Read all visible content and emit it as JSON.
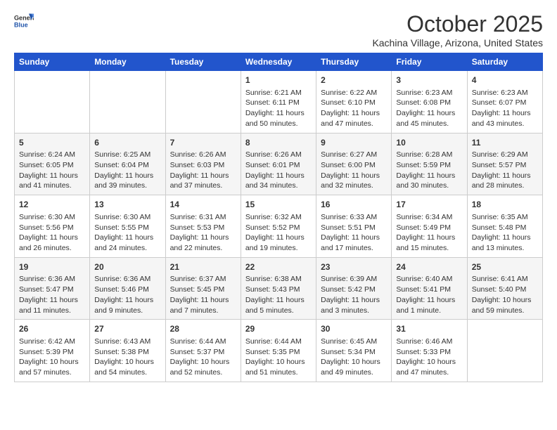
{
  "header": {
    "logo_general": "General",
    "logo_blue": "Blue",
    "month_title": "October 2025",
    "location": "Kachina Village, Arizona, United States"
  },
  "weekdays": [
    "Sunday",
    "Monday",
    "Tuesday",
    "Wednesday",
    "Thursday",
    "Friday",
    "Saturday"
  ],
  "weeks": [
    [
      {
        "date": "",
        "info": ""
      },
      {
        "date": "",
        "info": ""
      },
      {
        "date": "",
        "info": ""
      },
      {
        "date": "1",
        "info": "Sunrise: 6:21 AM\nSunset: 6:11 PM\nDaylight: 11 hours\nand 50 minutes."
      },
      {
        "date": "2",
        "info": "Sunrise: 6:22 AM\nSunset: 6:10 PM\nDaylight: 11 hours\nand 47 minutes."
      },
      {
        "date": "3",
        "info": "Sunrise: 6:23 AM\nSunset: 6:08 PM\nDaylight: 11 hours\nand 45 minutes."
      },
      {
        "date": "4",
        "info": "Sunrise: 6:23 AM\nSunset: 6:07 PM\nDaylight: 11 hours\nand 43 minutes."
      }
    ],
    [
      {
        "date": "5",
        "info": "Sunrise: 6:24 AM\nSunset: 6:05 PM\nDaylight: 11 hours\nand 41 minutes."
      },
      {
        "date": "6",
        "info": "Sunrise: 6:25 AM\nSunset: 6:04 PM\nDaylight: 11 hours\nand 39 minutes."
      },
      {
        "date": "7",
        "info": "Sunrise: 6:26 AM\nSunset: 6:03 PM\nDaylight: 11 hours\nand 37 minutes."
      },
      {
        "date": "8",
        "info": "Sunrise: 6:26 AM\nSunset: 6:01 PM\nDaylight: 11 hours\nand 34 minutes."
      },
      {
        "date": "9",
        "info": "Sunrise: 6:27 AM\nSunset: 6:00 PM\nDaylight: 11 hours\nand 32 minutes."
      },
      {
        "date": "10",
        "info": "Sunrise: 6:28 AM\nSunset: 5:59 PM\nDaylight: 11 hours\nand 30 minutes."
      },
      {
        "date": "11",
        "info": "Sunrise: 6:29 AM\nSunset: 5:57 PM\nDaylight: 11 hours\nand 28 minutes."
      }
    ],
    [
      {
        "date": "12",
        "info": "Sunrise: 6:30 AM\nSunset: 5:56 PM\nDaylight: 11 hours\nand 26 minutes."
      },
      {
        "date": "13",
        "info": "Sunrise: 6:30 AM\nSunset: 5:55 PM\nDaylight: 11 hours\nand 24 minutes."
      },
      {
        "date": "14",
        "info": "Sunrise: 6:31 AM\nSunset: 5:53 PM\nDaylight: 11 hours\nand 22 minutes."
      },
      {
        "date": "15",
        "info": "Sunrise: 6:32 AM\nSunset: 5:52 PM\nDaylight: 11 hours\nand 19 minutes."
      },
      {
        "date": "16",
        "info": "Sunrise: 6:33 AM\nSunset: 5:51 PM\nDaylight: 11 hours\nand 17 minutes."
      },
      {
        "date": "17",
        "info": "Sunrise: 6:34 AM\nSunset: 5:49 PM\nDaylight: 11 hours\nand 15 minutes."
      },
      {
        "date": "18",
        "info": "Sunrise: 6:35 AM\nSunset: 5:48 PM\nDaylight: 11 hours\nand 13 minutes."
      }
    ],
    [
      {
        "date": "19",
        "info": "Sunrise: 6:36 AM\nSunset: 5:47 PM\nDaylight: 11 hours\nand 11 minutes."
      },
      {
        "date": "20",
        "info": "Sunrise: 6:36 AM\nSunset: 5:46 PM\nDaylight: 11 hours\nand 9 minutes."
      },
      {
        "date": "21",
        "info": "Sunrise: 6:37 AM\nSunset: 5:45 PM\nDaylight: 11 hours\nand 7 minutes."
      },
      {
        "date": "22",
        "info": "Sunrise: 6:38 AM\nSunset: 5:43 PM\nDaylight: 11 hours\nand 5 minutes."
      },
      {
        "date": "23",
        "info": "Sunrise: 6:39 AM\nSunset: 5:42 PM\nDaylight: 11 hours\nand 3 minutes."
      },
      {
        "date": "24",
        "info": "Sunrise: 6:40 AM\nSunset: 5:41 PM\nDaylight: 11 hours\nand 1 minute."
      },
      {
        "date": "25",
        "info": "Sunrise: 6:41 AM\nSunset: 5:40 PM\nDaylight: 10 hours\nand 59 minutes."
      }
    ],
    [
      {
        "date": "26",
        "info": "Sunrise: 6:42 AM\nSunset: 5:39 PM\nDaylight: 10 hours\nand 57 minutes."
      },
      {
        "date": "27",
        "info": "Sunrise: 6:43 AM\nSunset: 5:38 PM\nDaylight: 10 hours\nand 54 minutes."
      },
      {
        "date": "28",
        "info": "Sunrise: 6:44 AM\nSunset: 5:37 PM\nDaylight: 10 hours\nand 52 minutes."
      },
      {
        "date": "29",
        "info": "Sunrise: 6:44 AM\nSunset: 5:35 PM\nDaylight: 10 hours\nand 51 minutes."
      },
      {
        "date": "30",
        "info": "Sunrise: 6:45 AM\nSunset: 5:34 PM\nDaylight: 10 hours\nand 49 minutes."
      },
      {
        "date": "31",
        "info": "Sunrise: 6:46 AM\nSunset: 5:33 PM\nDaylight: 10 hours\nand 47 minutes."
      },
      {
        "date": "",
        "info": ""
      }
    ]
  ]
}
